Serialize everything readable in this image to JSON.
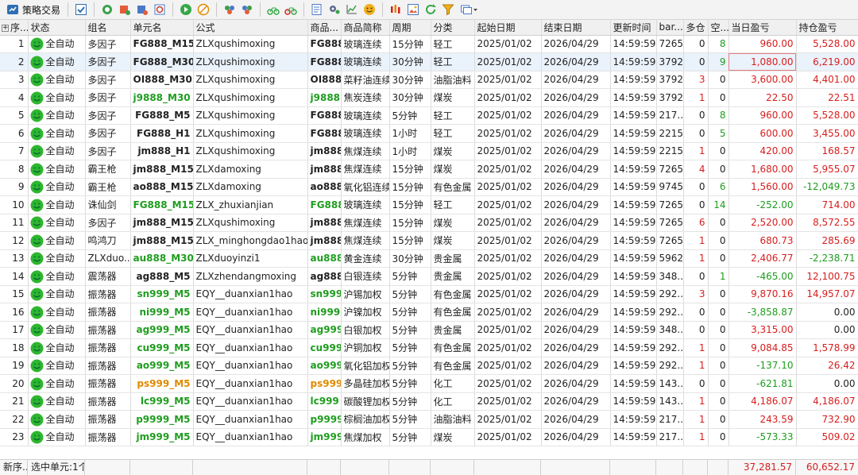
{
  "toolbar": {
    "app_label": "策略交易",
    "icons": [
      "checklist-icon",
      "globe-refresh-icon",
      "chart-badge-icon",
      "chart-switch-icon",
      "chart-refresh-icon",
      "play-icon",
      "stop-icon",
      "group-icon",
      "group-settings-icon",
      "bicycle-icon",
      "bicycle-stop-icon",
      "report-icon",
      "settings-icon",
      "line-chart-icon",
      "smiley-icon",
      "candlestick-icon",
      "image-report-icon",
      "refresh-icon",
      "filter-icon",
      "window-dropdown-icon"
    ]
  },
  "grid": {
    "headers": [
      "序...",
      "状态",
      "组名",
      "单元名",
      "公式",
      "商品...",
      "商品简称",
      "周期",
      "分类",
      "起始日期",
      "结束日期",
      "更新时间",
      "bar...",
      "多仓",
      "空...",
      "当日盈亏",
      "持仓盈亏"
    ],
    "rows": [
      {
        "idx": "1",
        "status": "全自动",
        "group": "多因子",
        "unit": "FG888_M15",
        "unit_color": "black",
        "formula": "ZLXqushimoxing",
        "code": "FG888",
        "code_color": "black",
        "name": "玻璃连续",
        "period": "15分钟",
        "category": "轻工",
        "start": "2025/01/02",
        "end": "2026/04/29",
        "update": "14:59:59",
        "bar": "7265",
        "long": "0",
        "long_color": "black",
        "short": "8",
        "short_color": "green",
        "day_pnl": "960.00",
        "day_color": "red",
        "pos_pnl": "5,528.00",
        "pos_color": "red"
      },
      {
        "idx": "2",
        "status": "全自动",
        "group": "多因子",
        "unit": "FG888_M30",
        "unit_color": "black",
        "formula": "ZLXqushimoxing",
        "code": "FG888",
        "code_color": "black",
        "name": "玻璃连续",
        "period": "30分钟",
        "category": "轻工",
        "start": "2025/01/02",
        "end": "2026/04/29",
        "update": "14:59:59",
        "bar": "3792",
        "long": "0",
        "long_color": "black",
        "short": "9",
        "short_color": "green",
        "day_pnl": "1,080.00",
        "day_color": "red",
        "pos_pnl": "6,219.00",
        "pos_color": "red",
        "selected": true
      },
      {
        "idx": "3",
        "status": "全自动",
        "group": "多因子",
        "unit": "OI888_M30",
        "unit_color": "black",
        "formula": "ZLXqushimoxing",
        "code": "OI888",
        "code_color": "black",
        "name": "菜籽油连续",
        "period": "30分钟",
        "category": "油脂油料",
        "start": "2025/01/02",
        "end": "2026/04/29",
        "update": "14:59:59",
        "bar": "3792",
        "long": "3",
        "long_color": "red",
        "short": "0",
        "short_color": "black",
        "day_pnl": "3,600.00",
        "day_color": "red",
        "pos_pnl": "4,401.00",
        "pos_color": "red"
      },
      {
        "idx": "4",
        "status": "全自动",
        "group": "多因子",
        "unit": "j9888_M30",
        "unit_color": "green",
        "formula": "ZLXqushimoxing",
        "code": "j9888",
        "code_color": "green",
        "name": "焦炭连续",
        "period": "30分钟",
        "category": "煤炭",
        "start": "2025/01/02",
        "end": "2026/04/29",
        "update": "14:59:59",
        "bar": "3792",
        "long": "1",
        "long_color": "red",
        "short": "0",
        "short_color": "black",
        "day_pnl": "22.50",
        "day_color": "red",
        "pos_pnl": "22.51",
        "pos_color": "red"
      },
      {
        "idx": "5",
        "status": "全自动",
        "group": "多因子",
        "unit": "FG888_M5",
        "unit_color": "black",
        "formula": "ZLXqushimoxing",
        "code": "FG888",
        "code_color": "black",
        "name": "玻璃连续",
        "period": "5分钟",
        "category": "轻工",
        "start": "2025/01/02",
        "end": "2026/04/29",
        "update": "14:59:59",
        "bar": "217...",
        "long": "0",
        "long_color": "black",
        "short": "8",
        "short_color": "green",
        "day_pnl": "960.00",
        "day_color": "red",
        "pos_pnl": "5,528.00",
        "pos_color": "red"
      },
      {
        "idx": "6",
        "status": "全自动",
        "group": "多因子",
        "unit": "FG888_H1",
        "unit_color": "black",
        "formula": "ZLXqushimoxing",
        "code": "FG888",
        "code_color": "black",
        "name": "玻璃连续",
        "period": "1小时",
        "category": "轻工",
        "start": "2025/01/02",
        "end": "2026/04/29",
        "update": "14:59:59",
        "bar": "2215",
        "long": "0",
        "long_color": "black",
        "short": "5",
        "short_color": "green",
        "day_pnl": "600.00",
        "day_color": "red",
        "pos_pnl": "3,455.00",
        "pos_color": "red"
      },
      {
        "idx": "7",
        "status": "全自动",
        "group": "多因子",
        "unit": "jm888_H1",
        "unit_color": "black",
        "formula": "ZLXqushimoxing",
        "code": "jm888",
        "code_color": "black",
        "name": "焦煤连续",
        "period": "1小时",
        "category": "煤炭",
        "start": "2025/01/02",
        "end": "2026/04/29",
        "update": "14:59:59",
        "bar": "2215",
        "long": "1",
        "long_color": "red",
        "short": "0",
        "short_color": "black",
        "day_pnl": "420.00",
        "day_color": "red",
        "pos_pnl": "168.57",
        "pos_color": "red"
      },
      {
        "idx": "8",
        "status": "全自动",
        "group": "霸王枪",
        "unit": "jm888_M15",
        "unit_color": "black",
        "formula": "ZLXdamoxing",
        "code": "jm888",
        "code_color": "black",
        "name": "焦煤连续",
        "period": "15分钟",
        "category": "煤炭",
        "start": "2025/01/02",
        "end": "2026/04/29",
        "update": "14:59:59",
        "bar": "7265",
        "long": "4",
        "long_color": "red",
        "short": "0",
        "short_color": "black",
        "day_pnl": "1,680.00",
        "day_color": "red",
        "pos_pnl": "5,955.07",
        "pos_color": "red"
      },
      {
        "idx": "9",
        "status": "全自动",
        "group": "霸王枪",
        "unit": "ao888_M15",
        "unit_color": "black",
        "formula": "ZLXdamoxing",
        "code": "ao888",
        "code_color": "black",
        "name": "氧化铝连续",
        "period": "15分钟",
        "category": "有色金属",
        "start": "2025/01/02",
        "end": "2026/04/29",
        "update": "14:59:59",
        "bar": "9745",
        "long": "0",
        "long_color": "black",
        "short": "6",
        "short_color": "green",
        "day_pnl": "1,560.00",
        "day_color": "red",
        "pos_pnl": "-12,049.73",
        "pos_color": "green"
      },
      {
        "idx": "10",
        "status": "全自动",
        "group": "诛仙剑",
        "unit": "FG888_M15",
        "unit_color": "green",
        "formula": "ZLX_zhuxianjian",
        "code": "FG888",
        "code_color": "green",
        "name": "玻璃连续",
        "period": "15分钟",
        "category": "轻工",
        "start": "2025/01/02",
        "end": "2026/04/29",
        "update": "14:59:59",
        "bar": "7265",
        "long": "0",
        "long_color": "black",
        "short": "14",
        "short_color": "green",
        "day_pnl": "-252.00",
        "day_color": "green",
        "pos_pnl": "714.00",
        "pos_color": "red"
      },
      {
        "idx": "11",
        "status": "全自动",
        "group": "多因子",
        "unit": "jm888_M15",
        "unit_color": "black",
        "formula": "ZLXqushimoxing",
        "code": "jm888",
        "code_color": "black",
        "name": "焦煤连续",
        "period": "15分钟",
        "category": "煤炭",
        "start": "2025/01/02",
        "end": "2026/04/29",
        "update": "14:59:59",
        "bar": "7265",
        "long": "6",
        "long_color": "red",
        "short": "0",
        "short_color": "black",
        "day_pnl": "2,520.00",
        "day_color": "red",
        "pos_pnl": "8,572.55",
        "pos_color": "red"
      },
      {
        "idx": "12",
        "status": "全自动",
        "group": "鸣鸿刀",
        "unit": "jm888_M15",
        "unit_color": "black",
        "formula": "ZLX_minghongdao1hao",
        "code": "jm888",
        "code_color": "black",
        "name": "焦煤连续",
        "period": "15分钟",
        "category": "煤炭",
        "start": "2025/01/02",
        "end": "2026/04/29",
        "update": "14:59:59",
        "bar": "7265",
        "long": "1",
        "long_color": "red",
        "short": "0",
        "short_color": "black",
        "day_pnl": "680.73",
        "day_color": "red",
        "pos_pnl": "285.69",
        "pos_color": "red"
      },
      {
        "idx": "13",
        "status": "全自动",
        "group": "ZLXduo...",
        "unit": "au888_M30",
        "unit_color": "green",
        "formula": "ZLXduoyinzi1",
        "code": "au888",
        "code_color": "green",
        "name": "黄金连续",
        "period": "30分钟",
        "category": "贵金属",
        "start": "2025/01/02",
        "end": "2026/04/29",
        "update": "14:59:59",
        "bar": "5962",
        "long": "1",
        "long_color": "red",
        "short": "0",
        "short_color": "black",
        "day_pnl": "2,406.77",
        "day_color": "red",
        "pos_pnl": "-2,238.71",
        "pos_color": "green"
      },
      {
        "idx": "14",
        "status": "全自动",
        "group": "震荡器",
        "unit": "ag888_M5",
        "unit_color": "black",
        "formula": "ZLXzhendangmoxing",
        "code": "ag888",
        "code_color": "black",
        "name": "白银连续",
        "period": "5分钟",
        "category": "贵金属",
        "start": "2025/01/02",
        "end": "2026/04/29",
        "update": "14:59:59",
        "bar": "348...",
        "long": "0",
        "long_color": "black",
        "short": "1",
        "short_color": "green",
        "day_pnl": "-465.00",
        "day_color": "green",
        "pos_pnl": "12,100.75",
        "pos_color": "red"
      },
      {
        "idx": "15",
        "status": "全自动",
        "group": "振荡器",
        "unit": "sn999_M5",
        "unit_color": "green",
        "formula": "EQY__duanxian1hao",
        "code": "sn999",
        "code_color": "green",
        "name": "沪锡加权",
        "period": "5分钟",
        "category": "有色金属",
        "start": "2025/01/02",
        "end": "2026/04/29",
        "update": "14:59:59",
        "bar": "292...",
        "long": "3",
        "long_color": "red",
        "short": "0",
        "short_color": "black",
        "day_pnl": "9,870.16",
        "day_color": "red",
        "pos_pnl": "14,957.07",
        "pos_color": "red"
      },
      {
        "idx": "16",
        "status": "全自动",
        "group": "振荡器",
        "unit": "ni999_M5",
        "unit_color": "green",
        "formula": "EQY__duanxian1hao",
        "code": "ni999",
        "code_color": "green",
        "name": "沪镍加权",
        "period": "5分钟",
        "category": "有色金属",
        "start": "2025/01/02",
        "end": "2026/04/29",
        "update": "14:59:59",
        "bar": "292...",
        "long": "0",
        "long_color": "black",
        "short": "0",
        "short_color": "black",
        "day_pnl": "-3,858.87",
        "day_color": "green",
        "pos_pnl": "0.00",
        "pos_color": "black"
      },
      {
        "idx": "17",
        "status": "全自动",
        "group": "振荡器",
        "unit": "ag999_M5",
        "unit_color": "green",
        "formula": "EQY__duanxian1hao",
        "code": "ag999",
        "code_color": "green",
        "name": "白银加权",
        "period": "5分钟",
        "category": "贵金属",
        "start": "2025/01/02",
        "end": "2026/04/29",
        "update": "14:59:59",
        "bar": "348...",
        "long": "0",
        "long_color": "black",
        "short": "0",
        "short_color": "black",
        "day_pnl": "3,315.00",
        "day_color": "red",
        "pos_pnl": "0.00",
        "pos_color": "black"
      },
      {
        "idx": "18",
        "status": "全自动",
        "group": "振荡器",
        "unit": "cu999_M5",
        "unit_color": "green",
        "formula": "EQY__duanxian1hao",
        "code": "cu999",
        "code_color": "green",
        "name": "沪铜加权",
        "period": "5分钟",
        "category": "有色金属",
        "start": "2025/01/02",
        "end": "2026/04/29",
        "update": "14:59:59",
        "bar": "292...",
        "long": "1",
        "long_color": "red",
        "short": "0",
        "short_color": "black",
        "day_pnl": "9,084.85",
        "day_color": "red",
        "pos_pnl": "1,578.99",
        "pos_color": "red"
      },
      {
        "idx": "19",
        "status": "全自动",
        "group": "振荡器",
        "unit": "ao999_M5",
        "unit_color": "green",
        "formula": "EQY__duanxian1hao",
        "code": "ao999",
        "code_color": "green",
        "name": "氧化铝加权",
        "period": "5分钟",
        "category": "有色金属",
        "start": "2025/01/02",
        "end": "2026/04/29",
        "update": "14:59:59",
        "bar": "292...",
        "long": "1",
        "long_color": "red",
        "short": "0",
        "short_color": "black",
        "day_pnl": "-137.10",
        "day_color": "green",
        "pos_pnl": "26.42",
        "pos_color": "red"
      },
      {
        "idx": "20",
        "status": "全自动",
        "group": "振荡器",
        "unit": "ps999_M5",
        "unit_color": "orange",
        "formula": "EQY__duanxian1hao",
        "code": "ps999",
        "code_color": "orange",
        "name": "多晶硅加权",
        "period": "5分钟",
        "category": "化工",
        "start": "2025/01/02",
        "end": "2026/04/29",
        "update": "14:59:59",
        "bar": "143...",
        "long": "0",
        "long_color": "black",
        "short": "0",
        "short_color": "black",
        "day_pnl": "-621.81",
        "day_color": "green",
        "pos_pnl": "0.00",
        "pos_color": "black"
      },
      {
        "idx": "21",
        "status": "全自动",
        "group": "振荡器",
        "unit": "lc999_M5",
        "unit_color": "green",
        "formula": "EQY__duanxian1hao",
        "code": "lc999",
        "code_color": "green",
        "name": "碳酸锂加权",
        "period": "5分钟",
        "category": "化工",
        "start": "2025/01/02",
        "end": "2026/04/29",
        "update": "14:59:59",
        "bar": "143...",
        "long": "1",
        "long_color": "red",
        "short": "0",
        "short_color": "black",
        "day_pnl": "4,186.07",
        "day_color": "red",
        "pos_pnl": "4,186.07",
        "pos_color": "red"
      },
      {
        "idx": "22",
        "status": "全自动",
        "group": "振荡器",
        "unit": "p9999_M5",
        "unit_color": "green",
        "formula": "EQY__duanxian1hao",
        "code": "p9999",
        "code_color": "green",
        "name": "棕榈油加权",
        "period": "5分钟",
        "category": "油脂油料",
        "start": "2025/01/02",
        "end": "2026/04/29",
        "update": "14:59:59",
        "bar": "217...",
        "long": "1",
        "long_color": "red",
        "short": "0",
        "short_color": "black",
        "day_pnl": "243.59",
        "day_color": "red",
        "pos_pnl": "732.90",
        "pos_color": "red"
      },
      {
        "idx": "23",
        "status": "全自动",
        "group": "振荡器",
        "unit": "jm999_M5",
        "unit_color": "green",
        "formula": "EQY__duanxian1hao",
        "code": "jm999",
        "code_color": "green",
        "name": "焦煤加权",
        "period": "5分钟",
        "category": "煤炭",
        "start": "2025/01/02",
        "end": "2026/04/29",
        "update": "14:59:59",
        "bar": "217...",
        "long": "1",
        "long_color": "red",
        "short": "0",
        "short_color": "black",
        "day_pnl": "-573.33",
        "day_color": "green",
        "pos_pnl": "509.02",
        "pos_color": "red"
      }
    ]
  },
  "statusbar": {
    "new_seq": "新序...",
    "selected": "选中单元:1个",
    "total_day_pnl": "37,281.57",
    "total_pos_pnl": "60,652.17"
  },
  "colors": {
    "red": "#d81e1e",
    "green": "#1f9d1f",
    "orange": "#e08a00",
    "selected_row": "#eaf2fb",
    "smiley": "#2fb52f"
  }
}
